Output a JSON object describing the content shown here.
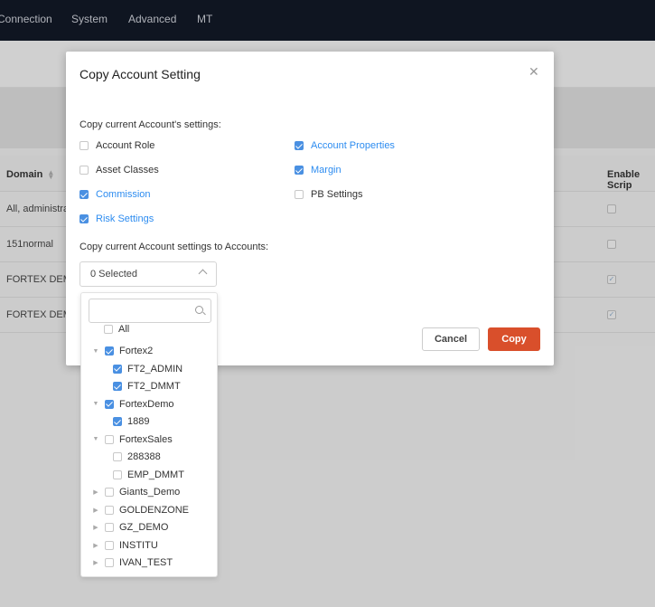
{
  "nav": {
    "items": [
      "Connection",
      "System",
      "Advanced",
      "MT"
    ]
  },
  "table": {
    "headers": {
      "domain": "Domain",
      "enable_script": "Enable Scrip"
    },
    "rows": [
      {
        "domain": "All, administra",
        "checked": false
      },
      {
        "domain": "151normal",
        "checked": false
      },
      {
        "domain": "FORTEX DEMO",
        "checked": true
      },
      {
        "domain": "FORTEX DEMO",
        "checked": true
      }
    ]
  },
  "modal": {
    "title": "Copy Account Setting",
    "copy_settings_label": "Copy current Account's settings:",
    "options": [
      {
        "label": "Account Role",
        "checked": false
      },
      {
        "label": "Asset Classes",
        "checked": false
      },
      {
        "label": "Commission",
        "checked": true
      },
      {
        "label": "Risk Settings",
        "checked": true
      },
      {
        "label": "Account Properties",
        "checked": true
      },
      {
        "label": "Margin",
        "checked": true
      },
      {
        "label": "PB Settings",
        "checked": false
      }
    ],
    "copy_to_label": "Copy current Account settings to Accounts:",
    "select_value": "0 Selected",
    "cancel_label": "Cancel",
    "copy_label": "Copy"
  },
  "dropdown": {
    "search_placeholder": "",
    "all_label": "All",
    "tree": [
      {
        "label": "Fortex2",
        "level": 0,
        "caret": "down",
        "checked": true
      },
      {
        "label": "FT2_ADMIN",
        "level": 1,
        "caret": "",
        "checked": true
      },
      {
        "label": "FT2_DMMT",
        "level": 1,
        "caret": "",
        "checked": true
      },
      {
        "label": "FortexDemo",
        "level": 0,
        "caret": "down",
        "checked": true
      },
      {
        "label": "1889",
        "level": 1,
        "caret": "",
        "checked": true
      },
      {
        "label": "FortexSales",
        "level": 0,
        "caret": "down",
        "checked": false
      },
      {
        "label": "288388",
        "level": 1,
        "caret": "",
        "checked": false
      },
      {
        "label": "EMP_DMMT",
        "level": 1,
        "caret": "",
        "checked": false
      },
      {
        "label": "Giants_Demo",
        "level": 0,
        "caret": "right",
        "checked": false
      },
      {
        "label": "GOLDENZONE",
        "level": 0,
        "caret": "right",
        "checked": false
      },
      {
        "label": "GZ_DEMO",
        "level": 0,
        "caret": "right",
        "checked": false
      },
      {
        "label": "INSTITU",
        "level": 0,
        "caret": "right",
        "checked": false
      },
      {
        "label": "IVAN_TEST",
        "level": 0,
        "caret": "right",
        "checked": false
      }
    ]
  },
  "colors": {
    "accent": "#4a90e2",
    "primary_button": "#d94f2b",
    "nav_bg": "#121826"
  }
}
